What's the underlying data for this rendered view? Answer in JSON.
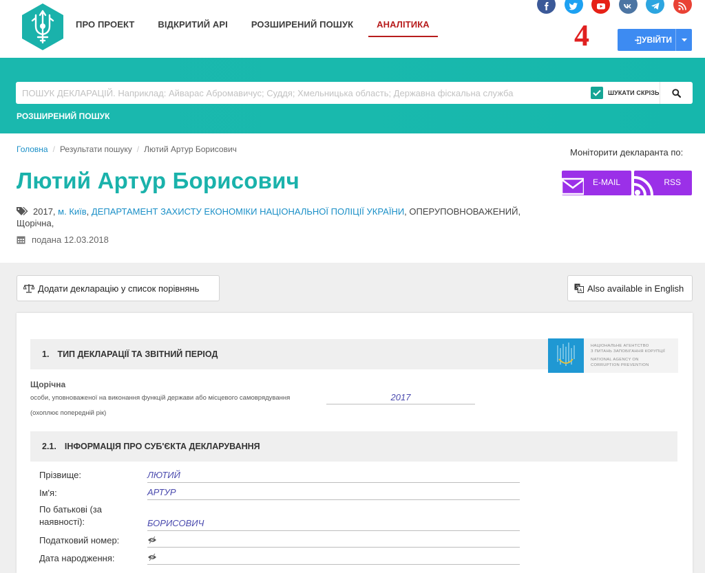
{
  "header": {
    "nav": [
      {
        "label": "ПРО ПРОЕКТ"
      },
      {
        "label": "ВІДКРИТИЙ API"
      },
      {
        "label": "РОЗШИРЕНИЙ ПОШУК"
      },
      {
        "label": "АНАЛІТИКА",
        "active": true
      }
    ],
    "socials": [
      {
        "icon": "facebook-icon",
        "color": "#3b5998"
      },
      {
        "icon": "twitter-icon",
        "color": "#1da1f2"
      },
      {
        "icon": "youtube-icon",
        "color": "#e62117"
      },
      {
        "icon": "vk-icon",
        "color": "#4c75a3"
      },
      {
        "icon": "telegram-icon",
        "color": "#2ca5e0"
      },
      {
        "icon": "rss-icon",
        "color": "#e94235"
      }
    ],
    "annotation_number": "4",
    "login_label": "УВІЙТИ"
  },
  "search": {
    "placeholder": "ПОШУК ДЕКЛАРАЦІЙ. Наприклад: Айварас Абромавичус; Суддя; Хмельницька область; Державна фіскальна служба",
    "everywhere_label": "ШУКАТИ СКРІЗЬ",
    "everywhere_checked": true,
    "advanced_label": "РОЗШИРЕНИЙ ПОШУК"
  },
  "breadcrumb": {
    "home": "Головна",
    "results": "Результати пошуку",
    "current": "Лютий Артур Борисович"
  },
  "profile": {
    "name": "Лютий Артур Борисович",
    "monitor_label": "Моніторити декларанта по:",
    "email_label": "E-MAIL",
    "rss_label": "RSS",
    "year": "2017",
    "city": "м. Київ",
    "organization": "ДЕПАРТАМЕНТ ЗАХИСТУ ЕКОНОМІКИ НАЦІОНАЛЬНОЇ ПОЛІЦІЇ УКРАЇНИ",
    "position": "ОПЕРУПОВНОВАЖЕНИЙ",
    "declaration_type": "Щорічна",
    "submitted": "подана 12.03.2018"
  },
  "actions": {
    "compare_label": "Додати декларацію у список порівнянь",
    "english_label": "Also available in English"
  },
  "declaration": {
    "section1": {
      "num": "1.",
      "title": "ТИП ДЕКЛАРАЦІЇ ТА ЗВІТНИЙ ПЕРІОД",
      "type_title": "Щорічна",
      "type_desc": "особи, уповноваженої на виконання функцій держави або місцевого самоврядування",
      "type_note": "(охоплює попередній рік)",
      "year": "2017"
    },
    "nazk": {
      "ua_line1": "Національне агентство",
      "ua_line2": "з питань запобігання корупції",
      "en_line1": "National agency on",
      "en_line2": "corruption prevention"
    },
    "section2": {
      "num": "2.1.",
      "title": "ІНФОРМАЦІЯ ПРО СУБ'ЄКТА ДЕКЛАРУВАННЯ",
      "fields": [
        {
          "label": "Прізвище:",
          "value": "ЛЮТИЙ"
        },
        {
          "label": "Ім'я:",
          "value": "АРТУР"
        },
        {
          "label": "По батькові (за наявності):",
          "value": "БОРИСОВИЧ"
        },
        {
          "label": "Податковий номер:",
          "value": ""
        },
        {
          "label": "Дата народження:",
          "value": ""
        }
      ]
    }
  },
  "colors": {
    "teal": "#1ab2ab",
    "active_nav": "#b71c1c",
    "login": "#3d8bf2",
    "monitor": "#9b30e8",
    "link": "#1a8fc7"
  }
}
